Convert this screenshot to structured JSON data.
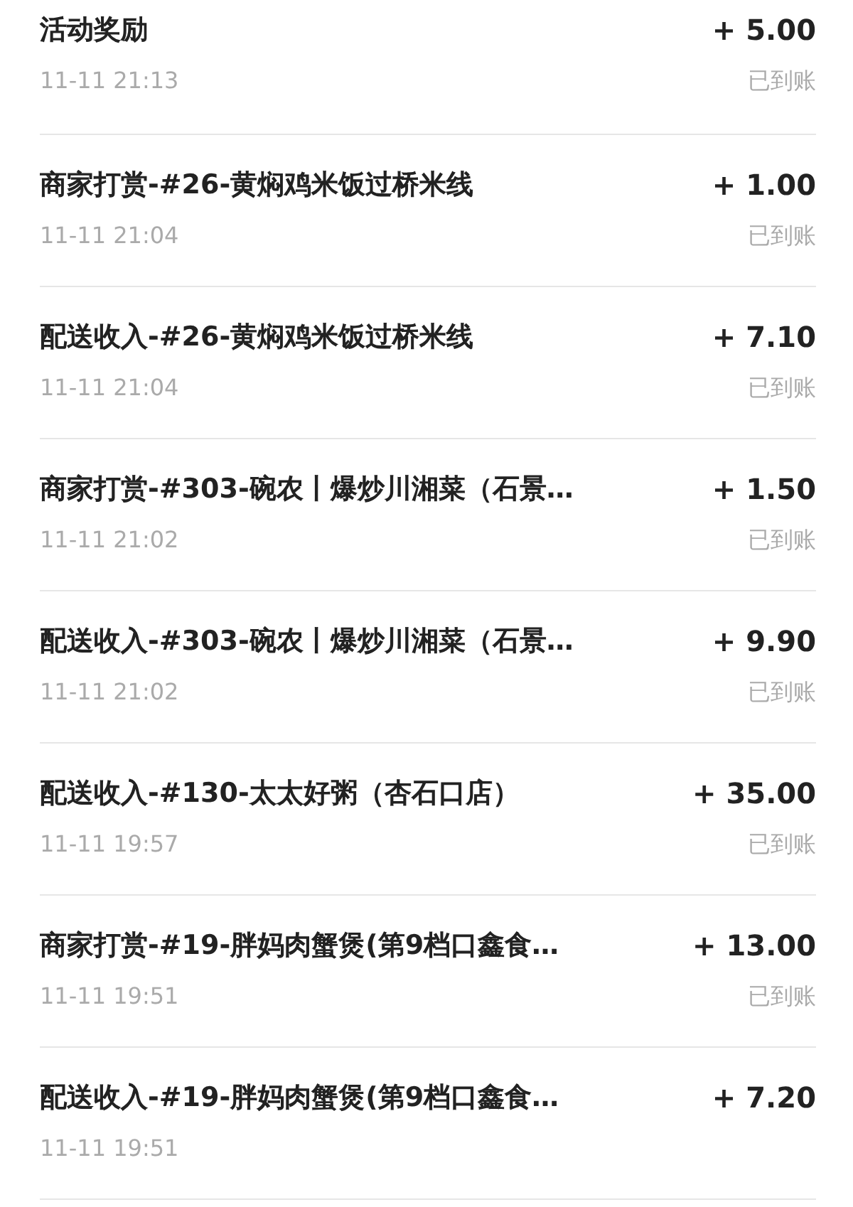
{
  "transactions": [
    {
      "title": "活动奖励",
      "time": "11-11 21:13",
      "amount": "+ 5.00",
      "status": "已到账"
    },
    {
      "title": "商家打赏-#26-黄焖鸡米饭过桥米线",
      "time": "11-11 21:04",
      "amount": "+ 1.00",
      "status": "已到账"
    },
    {
      "title": "配送收入-#26-黄焖鸡米饭过桥米线",
      "time": "11-11 21:04",
      "amount": "+ 7.10",
      "status": "已到账"
    },
    {
      "title": "商家打赏-#303-碗农丨爆炒川湘菜（石景…",
      "time": "11-11 21:02",
      "amount": "+ 1.50",
      "status": "已到账"
    },
    {
      "title": "配送收入-#303-碗农丨爆炒川湘菜（石景…",
      "time": "11-11 21:02",
      "amount": "+ 9.90",
      "status": "已到账"
    },
    {
      "title": "配送收入-#130-太太好粥（杏石口店）",
      "time": "11-11 19:57",
      "amount": "+ 35.00",
      "status": "已到账"
    },
    {
      "title": "商家打赏-#19-胖妈肉蟹煲(第9档口鑫食…",
      "time": "11-11 19:51",
      "amount": "+ 13.00",
      "status": "已到账"
    },
    {
      "title": "配送收入-#19-胖妈肉蟹煲(第9档口鑫食…",
      "time": "11-11 19:51",
      "amount": "+ 7.20"
    }
  ]
}
